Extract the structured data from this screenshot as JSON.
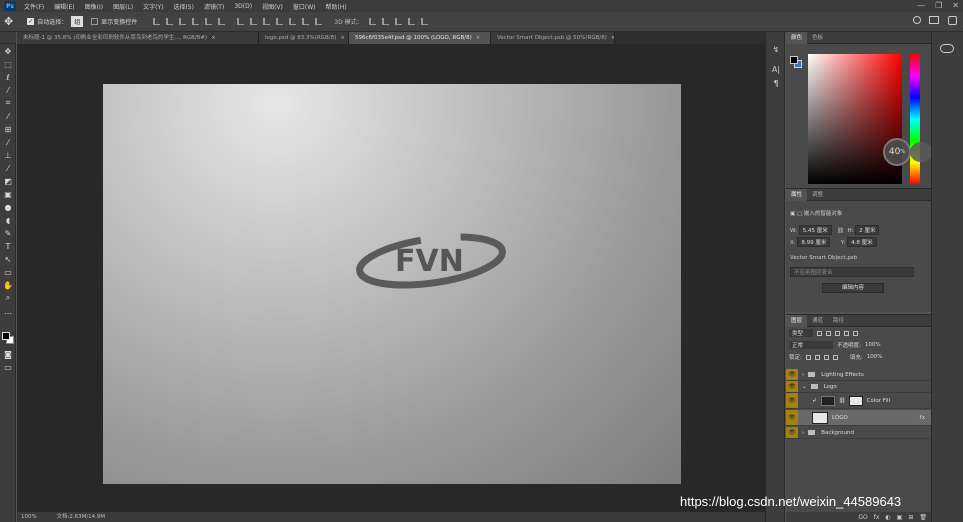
{
  "menubar": {
    "app_icon": "Ps",
    "items": [
      "文件(F)",
      "编辑(E)",
      "图像(I)",
      "图层(L)",
      "文字(Y)",
      "选择(S)",
      "滤镜(T)",
      "3D(D)",
      "视图(V)",
      "窗口(W)",
      "帮助(H)"
    ],
    "window_controls": [
      "—",
      "❐",
      "✕"
    ]
  },
  "options": {
    "auto_select_label": "自动选择：",
    "auto_select_value": "组",
    "transform_label": "显示变换控件",
    "mode_3d_label": "3D 模式："
  },
  "tabs": [
    {
      "label": "未标题-1 @ 35.8% (印刷业全彩印刷软件从菜鸟到老鸟的学生..., RGB/8#)",
      "close": "×"
    },
    {
      "label": "logo.psd @ 83.3%(RGB/8)",
      "close": "×"
    },
    {
      "label": "596c6f035e4f.psd @ 100% (LOGO, RGB/8)",
      "close": "×"
    },
    {
      "label": "Vector Smart Object.psb @ 50%(RGB/8)",
      "close": "×"
    }
  ],
  "document": {
    "logo_text": "FVN"
  },
  "status": {
    "zoom": "100%",
    "doc_info": "文档:2.63M/14.9M"
  },
  "color_panel": {
    "tabs": [
      "颜色",
      "色板"
    ],
    "perf_value": "40",
    "perf_unit": "%"
  },
  "properties": {
    "tabs": [
      "属性",
      "调整"
    ],
    "title": "嵌入的智能对象",
    "w_label": "W:",
    "w_value": "5.45 厘米",
    "h_label": "H:",
    "h_value": "2 厘米",
    "x_label": "X:",
    "x_value": "8.99 厘米",
    "y_label": "Y:",
    "y_value": "4.8 厘米",
    "file_name": "Vector Smart Object.psb",
    "layer_comp_placeholder": "不应用图层复合",
    "edit_button": "编辑内容"
  },
  "layers": {
    "tabs": [
      "图层",
      "通道",
      "路径"
    ],
    "kind_value": "类型",
    "blend_mode": "正常",
    "opacity_label": "不透明度:",
    "opacity_value": "100%",
    "lock_label": "锁定:",
    "fill_label": "填充:",
    "fill_value": "100%",
    "items": [
      {
        "name": "Lighting Effects",
        "type": "group"
      },
      {
        "name": "Logo",
        "type": "group"
      },
      {
        "name": "Color Fill",
        "type": "fill"
      },
      {
        "name": "LOGO",
        "type": "smart",
        "selected": true
      },
      {
        "name": "Background",
        "type": "group"
      }
    ],
    "footer_icons": [
      "GO",
      "fx",
      "◐",
      "▣",
      "⊞",
      "🗑"
    ]
  },
  "watermark": "https://blog.csdn.net/weixin_44589643"
}
